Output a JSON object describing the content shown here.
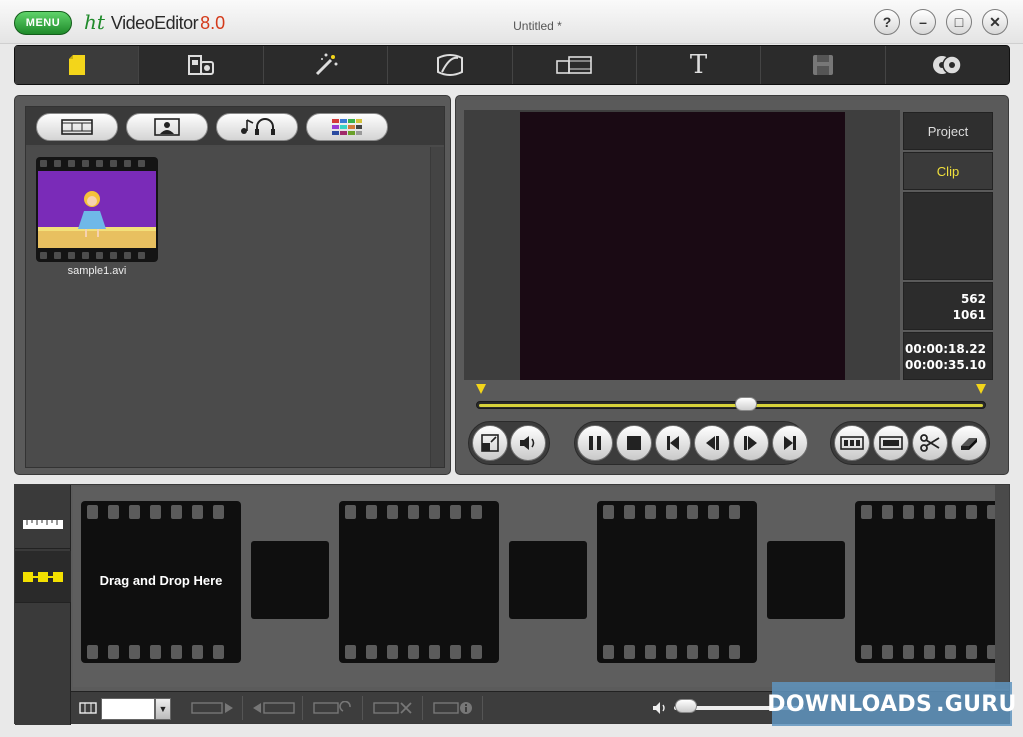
{
  "titlebar": {
    "menu_label": "MENU",
    "logo_prefix": "ht",
    "app_name": "VideoEditor",
    "version": "8.0",
    "document_title": "Untitled *",
    "help": "?",
    "minimize": "–",
    "maximize": "□",
    "close": "✕"
  },
  "toolbar": {
    "items": [
      {
        "icon": "new-project-icon",
        "active": true
      },
      {
        "icon": "capture-icon"
      },
      {
        "icon": "effects-wand-icon"
      },
      {
        "icon": "transitions-icon"
      },
      {
        "icon": "storyboard-icon"
      },
      {
        "icon": "text-icon",
        "glyph": "T"
      },
      {
        "icon": "save-icon"
      },
      {
        "icon": "burn-disc-icon"
      }
    ]
  },
  "media": {
    "tabs": [
      "video-clips-icon",
      "photos-icon",
      "audio-icon",
      "colors-icon"
    ],
    "items": [
      {
        "filename": "sample1.avi"
      }
    ]
  },
  "preview": {
    "side_tabs": {
      "project": "Project",
      "clip": "Clip"
    },
    "frame_current": "562",
    "frame_total": "1061",
    "time_current": "00:00:18.22",
    "time_total": "00:00:35.10",
    "playhead_fraction": 0.53
  },
  "timeline": {
    "drop_text": "Drag and Drop Here",
    "zoom_value": ""
  },
  "watermark": {
    "text_left": "DOWNLOADS",
    "text_right": ".GURU"
  },
  "colors": {
    "accent_green": "#1f8a2a",
    "version_red": "#d43a1a",
    "clip_tab_yellow": "#f0e03c",
    "marker_yellow": "#f3d51a"
  }
}
